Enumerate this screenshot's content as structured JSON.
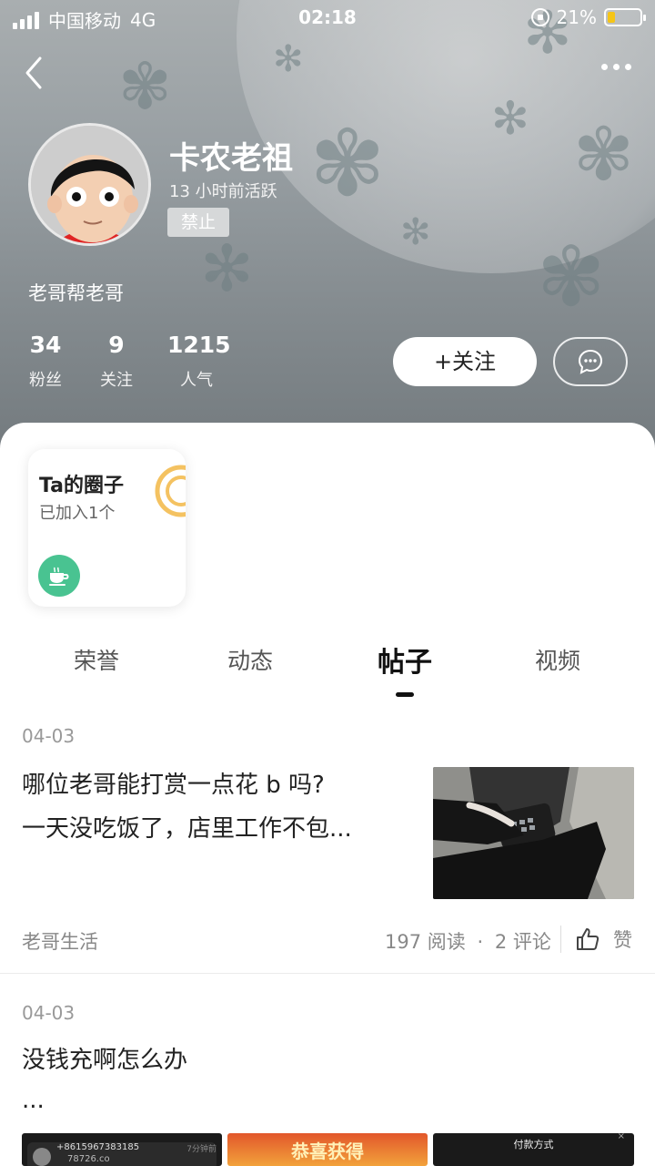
{
  "status_bar": {
    "carrier": "中国移动",
    "network": "4G",
    "time": "02:18",
    "battery": "21%"
  },
  "profile": {
    "name": "卡农老祖",
    "active": "13 小时前活跃",
    "badge": "禁止",
    "bio": "老哥帮老哥",
    "stats": [
      {
        "value": "34",
        "label": "粉丝"
      },
      {
        "value": "9",
        "label": "关注"
      },
      {
        "value": "1215",
        "label": "人气"
      }
    ],
    "follow_label": "+关注"
  },
  "circle": {
    "title": "Ta的圈子",
    "subtitle": "已加入1个"
  },
  "tabs": [
    {
      "label": "荣誉"
    },
    {
      "label": "动态"
    },
    {
      "label": "帖子",
      "active": true
    },
    {
      "label": "视频"
    }
  ],
  "posts": [
    {
      "date": "04-03",
      "title_line1": "哪位老哥能打赏一点花 b 吗?",
      "title_line2": "一天没吃饭了，店里工作不包...",
      "category": "老哥生活",
      "reads": "197 阅读",
      "dot": "·",
      "comments": "2 评论",
      "like_label": "赞"
    },
    {
      "date": "04-03",
      "title_line1": "没钱充啊怎么办",
      "title_line2": "...",
      "thumb1_text": "+8615967383185",
      "thumb1_sub": "78726.co",
      "thumb1_time": "7分钟前",
      "thumb2_text": "恭喜获得",
      "thumb3_text": "付款方式"
    }
  ]
}
